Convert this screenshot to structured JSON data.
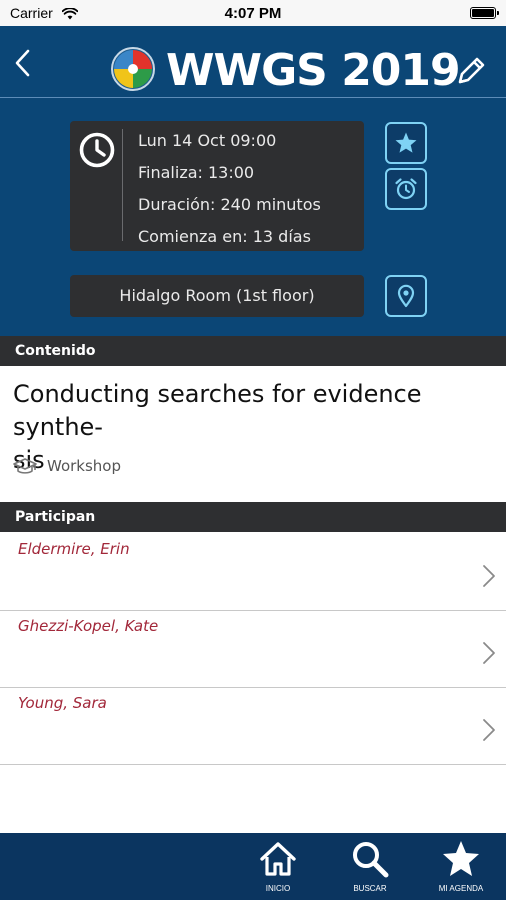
{
  "status_bar": {
    "carrier": "Carrier",
    "time": "4:07 PM"
  },
  "header": {
    "title": "WWGS 2019"
  },
  "session_info": {
    "start": "Lun 14  Oct  09:00",
    "ends": "Finaliza: 13:00",
    "duration": "Duración: 240 minutos",
    "starts_in": "Comienza en: 13 días"
  },
  "room": "Hidalgo Room (1st floor)",
  "content_section": {
    "header": "Contenido",
    "title": "Conducting searches for evidence synthe-\nsis",
    "type": "Workshop"
  },
  "participants_section": {
    "header": "Participan",
    "items": [
      {
        "name": "Eldermire, Erin"
      },
      {
        "name": "Ghezzi-Kopel, Kate"
      },
      {
        "name": "Young, Sara"
      }
    ]
  },
  "tabbar": {
    "home": "INICIO",
    "search": "BUSCAR",
    "agenda": "MI AGENDA"
  },
  "colors": {
    "header_bg": "#0b4676",
    "card_bg": "#2e2f31",
    "accent": "#7fd2f4",
    "participant_name": "#a2283a",
    "tabbar_bg": "#0b3560"
  },
  "icons": {
    "back": "chevron-left-icon",
    "edit": "pencil-icon",
    "clock": "clock-icon",
    "favorite": "star-icon",
    "alarm": "alarm-clock-icon",
    "location": "map-pin-icon",
    "type": "graduation-cap-icon",
    "row": "chevron-right-icon",
    "home": "home-icon",
    "search": "search-icon",
    "agenda": "star-icon"
  }
}
